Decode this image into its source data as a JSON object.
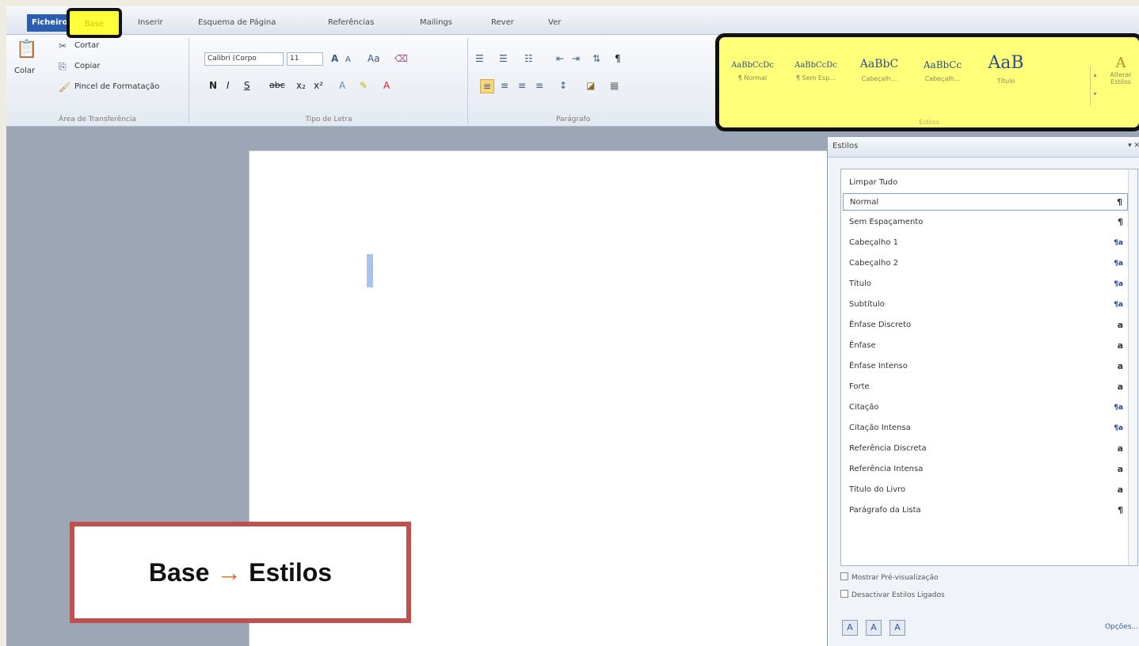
{
  "ribbon_tabs": [
    {
      "label": "Ficheiro"
    },
    {
      "label": "Base"
    },
    {
      "label": "Inserir"
    },
    {
      "label": "Esquema de Página"
    },
    {
      "label": "Referências"
    },
    {
      "label": "Mailings"
    },
    {
      "label": "Rever"
    },
    {
      "label": "Ver"
    }
  ],
  "clipboard": {
    "paste": "Colar",
    "cut": "Cortar",
    "copy": "Copiar",
    "format_painter": "Pincel de Formatação",
    "group": "Área de Transferência"
  },
  "font": {
    "name": "Calibri (Corpo",
    "size": "11",
    "group": "Tipo de Letra",
    "bold": "N",
    "italic": "I",
    "underline": "S",
    "strike": "abc"
  },
  "paragraph": {
    "group": "Parágrafo"
  },
  "styles_gallery": {
    "items": [
      {
        "sample": "AaBbCcDc",
        "name": "¶ Normal"
      },
      {
        "sample": "AaBbCcDc",
        "name": "¶ Sem Esp..."
      },
      {
        "sample": "AaBbC",
        "name": "Cabeçalh..."
      },
      {
        "sample": "AaBbCc",
        "name": "Cabeçalh..."
      },
      {
        "sample": "AaB",
        "name": "Título"
      }
    ],
    "change_styles": "Alterar Estilos",
    "group": "Estilos"
  },
  "styles_pane": {
    "title": "Estilos",
    "items": [
      {
        "name": "Limpar Tudo",
        "glyph": ""
      },
      {
        "name": "Normal",
        "glyph": "¶"
      },
      {
        "name": "Sem Espaçamento",
        "glyph": "¶"
      },
      {
        "name": "Cabeçalho 1",
        "glyph": "¶a"
      },
      {
        "name": "Cabeçalho 2",
        "glyph": "¶a"
      },
      {
        "name": "Título",
        "glyph": "¶a"
      },
      {
        "name": "Subtítulo",
        "glyph": "¶a"
      },
      {
        "name": "Ênfase Discreto",
        "glyph": "a"
      },
      {
        "name": "Ênfase",
        "glyph": "a"
      },
      {
        "name": "Ênfase Intenso",
        "glyph": "a"
      },
      {
        "name": "Forte",
        "glyph": "a"
      },
      {
        "name": "Citação",
        "glyph": "¶a"
      },
      {
        "name": "Citação Intensa",
        "glyph": "¶a"
      },
      {
        "name": "Referência Discreta",
        "glyph": "a"
      },
      {
        "name": "Referência Intensa",
        "glyph": "a"
      },
      {
        "name": "Título do Livro",
        "glyph": "a"
      },
      {
        "name": "Parágrafo da Lista",
        "glyph": "¶"
      }
    ],
    "show_preview": "Mostrar Pré-visualização",
    "disable_linked": "Desactivar Estilos Ligados",
    "options": "Opções..."
  },
  "callout": {
    "from": "Base",
    "arrow": "→",
    "to": "Estilos"
  }
}
